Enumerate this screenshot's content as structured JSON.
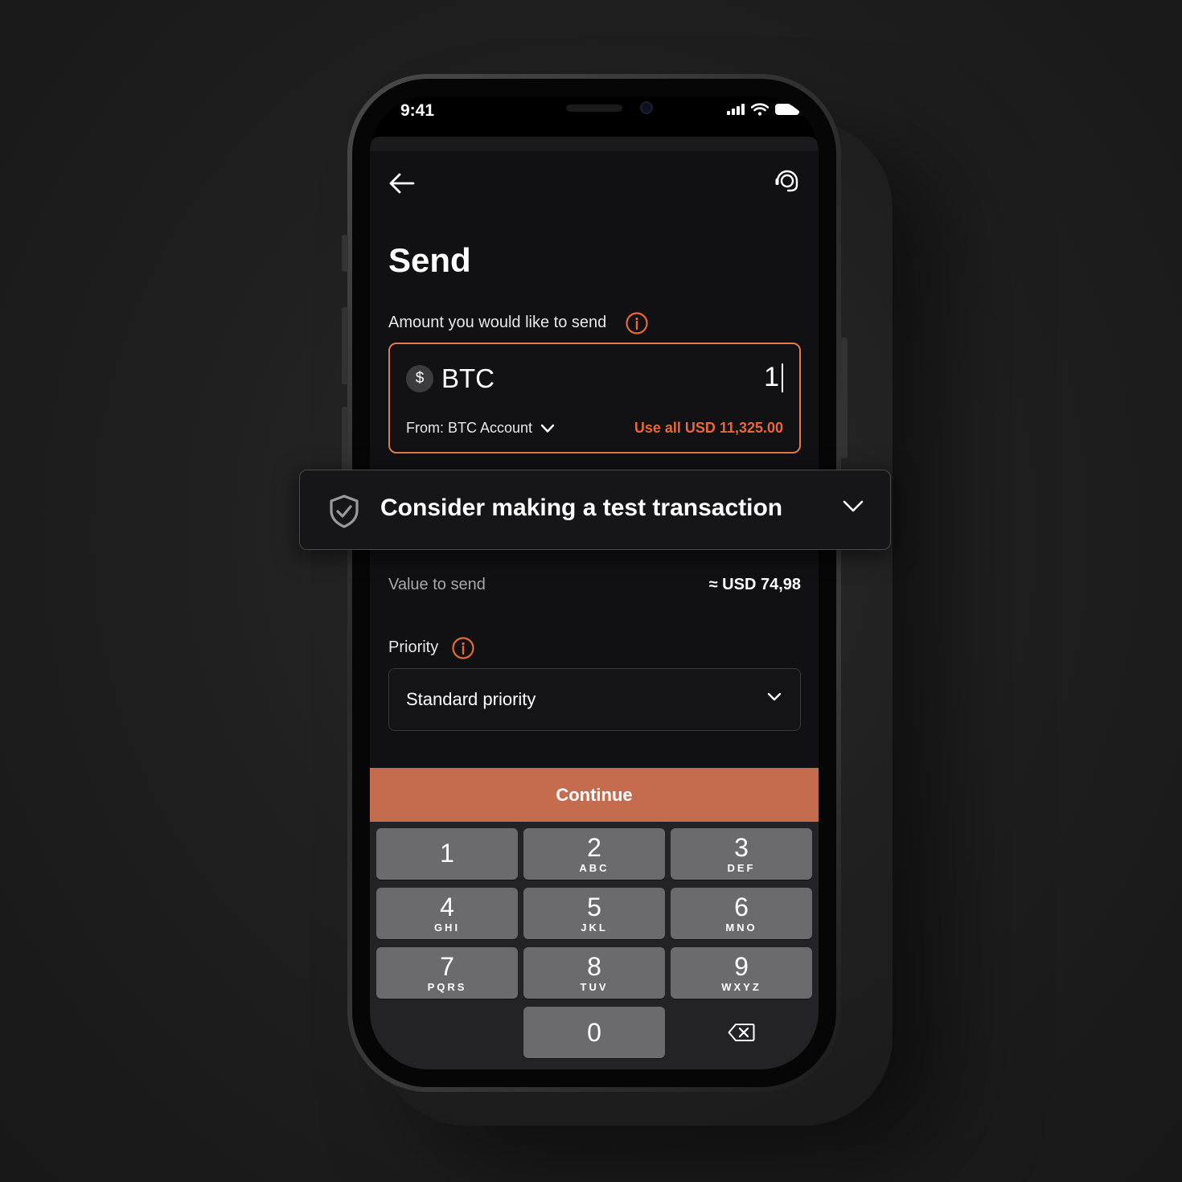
{
  "status_bar": {
    "time": "9:41"
  },
  "header": {
    "back_icon": "arrow-left-icon",
    "support_icon": "headset-support-icon",
    "title": "Send"
  },
  "amount": {
    "label": "Amount you would like to send",
    "info_icon": "info-icon",
    "currency_symbol": "$",
    "currency": "BTC",
    "value": "1",
    "from_account": "From: BTC Account",
    "use_all": "Use all USD 11,325.00"
  },
  "banner": {
    "icon": "shield-check-icon",
    "text": "Consider making a test transaction"
  },
  "value_to_send": {
    "label": "Value to send",
    "amount": "≈ USD 74,98"
  },
  "priority": {
    "label": "Priority",
    "selected": "Standard priority"
  },
  "continue_label": "Continue",
  "keypad": [
    {
      "num": "1",
      "letters": ""
    },
    {
      "num": "2",
      "letters": "ABC"
    },
    {
      "num": "3",
      "letters": "DEF"
    },
    {
      "num": "4",
      "letters": "GHI"
    },
    {
      "num": "5",
      "letters": "JKL"
    },
    {
      "num": "6",
      "letters": "MNO"
    },
    {
      "num": "7",
      "letters": "PQRS"
    },
    {
      "num": "8",
      "letters": "TUV"
    },
    {
      "num": "9",
      "letters": "WXYZ"
    },
    {
      "num": "0",
      "letters": ""
    }
  ],
  "colors": {
    "accent": "#e9683a",
    "continue_bg": "#c56c4e",
    "key_bg": "#6b6b6d",
    "screen_bg": "#111113"
  }
}
